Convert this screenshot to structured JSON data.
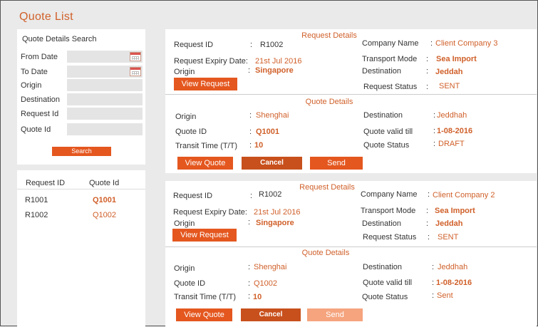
{
  "page": {
    "title": "Quote List"
  },
  "search": {
    "title": "Quote Details  Search",
    "from_date": "From Date",
    "to_date": "To    Date",
    "origin": "Origin",
    "destination": "Destination",
    "request_id": "Request Id",
    "quote_id": "Quote   Id",
    "button": "Search"
  },
  "results": {
    "col_request": "Request ID",
    "col_quote": "Quote   Id",
    "rows": [
      {
        "request_id": "R1001",
        "quote_id": "Q1001"
      },
      {
        "request_id": "R1002",
        "quote_id": "Q1002"
      }
    ]
  },
  "cards": [
    {
      "request_section": "Request Details",
      "request_id_label": "Request ID",
      "request_id": "R1002",
      "company_label": "Company  Name",
      "company": "Client Company 3",
      "expiry_label": "Request Expiry Date:",
      "expiry": "21st Jul 2016",
      "transport_label": "Transport Mode",
      "transport": "Sea Import",
      "origin_label": "Origin",
      "origin": "Singapore",
      "destination_label": "Destination",
      "destination": "Jeddah",
      "view_request": "View Request",
      "status_label": "Request  Status",
      "status": "SENT",
      "quote_section": "Quote Details",
      "q_origin_label": "Origin",
      "q_origin": "Shenghai",
      "q_destination_label": "Destination",
      "q_destination": "Jeddhah",
      "quote_id_label": "Quote ID",
      "quote_id": "Q1001",
      "valid_label": "Quote valid till",
      "valid": "1-08-2016",
      "transit_label": "Transit Time (T/T)",
      "transit": "10",
      "quote_status_label": "Quote Status",
      "quote_status": "DRAFT",
      "view_quote": "View Quote",
      "cancel": "Cancel",
      "send": "Send"
    },
    {
      "request_section": "Request Details",
      "request_id_label": "Request ID",
      "request_id": "R1002",
      "company_label": "Company  Name",
      "company": "Client Company 2",
      "expiry_label": "Request Expiry Date:",
      "expiry": "21st Jul 2016",
      "transport_label": "Transport Mode",
      "transport": "Sea Import",
      "origin_label": "Origin",
      "origin": "Singapore",
      "destination_label": "Destination",
      "destination": "Jeddah",
      "view_request": "View Request",
      "status_label": "Request   Status",
      "status": "SENT",
      "quote_section": "Quote Details",
      "q_origin_label": "Origin",
      "q_origin": "Shenghai",
      "q_destination_label": "Destination",
      "q_destination": "Jeddhah",
      "quote_id_label": "Quote ID",
      "quote_id": "Q1002",
      "valid_label": "Quote valid till",
      "valid": "1-08-2016",
      "transit_label": "Transit Time (T/T)",
      "transit": "10",
      "quote_status_label": "Quote Status",
      "quote_status": "Sent",
      "view_quote": "View Quote",
      "cancel": "Cancel",
      "send": "Send"
    }
  ],
  "colors": {
    "accent": "#e4571f",
    "text_accent": "#d0602a",
    "disabled": "#f5a47e"
  }
}
